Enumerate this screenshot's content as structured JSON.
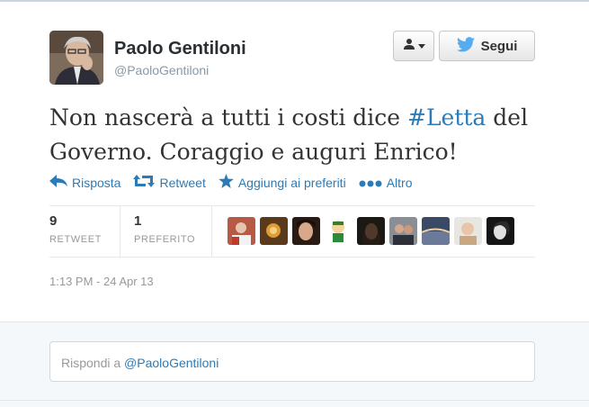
{
  "colors": {
    "link": "#2b7bb9",
    "muted": "#999999",
    "twitter_blue": "#55acee"
  },
  "author": {
    "name": "Paolo Gentiloni",
    "handle": "@PaoloGentiloni",
    "avatar_icon": "profile-photo"
  },
  "header": {
    "user_dropdown_icon": "user-dropdown-icon",
    "follow_label": "Segui"
  },
  "tweet": {
    "text_before": "Non nascerà a tutti i costi dice ",
    "hashtag": "#Letta",
    "text_after": " del Governo. Coraggio e auguri Enrico!"
  },
  "actions": {
    "reply": "Risposta",
    "retweet": "Retweet",
    "favorite": "Aggiungi ai preferiti",
    "more": "Altro"
  },
  "stats": {
    "retweets": {
      "count": "9",
      "label": "RETWEET"
    },
    "favorites": {
      "count": "1",
      "label": "PREFERITO"
    }
  },
  "faces": [
    "avatar-1",
    "avatar-2",
    "avatar-3",
    "avatar-4",
    "avatar-5",
    "avatar-6",
    "avatar-7",
    "avatar-8",
    "avatar-9"
  ],
  "timestamp": "1:13 PM - 24 Apr 13",
  "reply_box": {
    "prefix": "Rispondi a ",
    "mention": "@PaoloGentiloni"
  }
}
